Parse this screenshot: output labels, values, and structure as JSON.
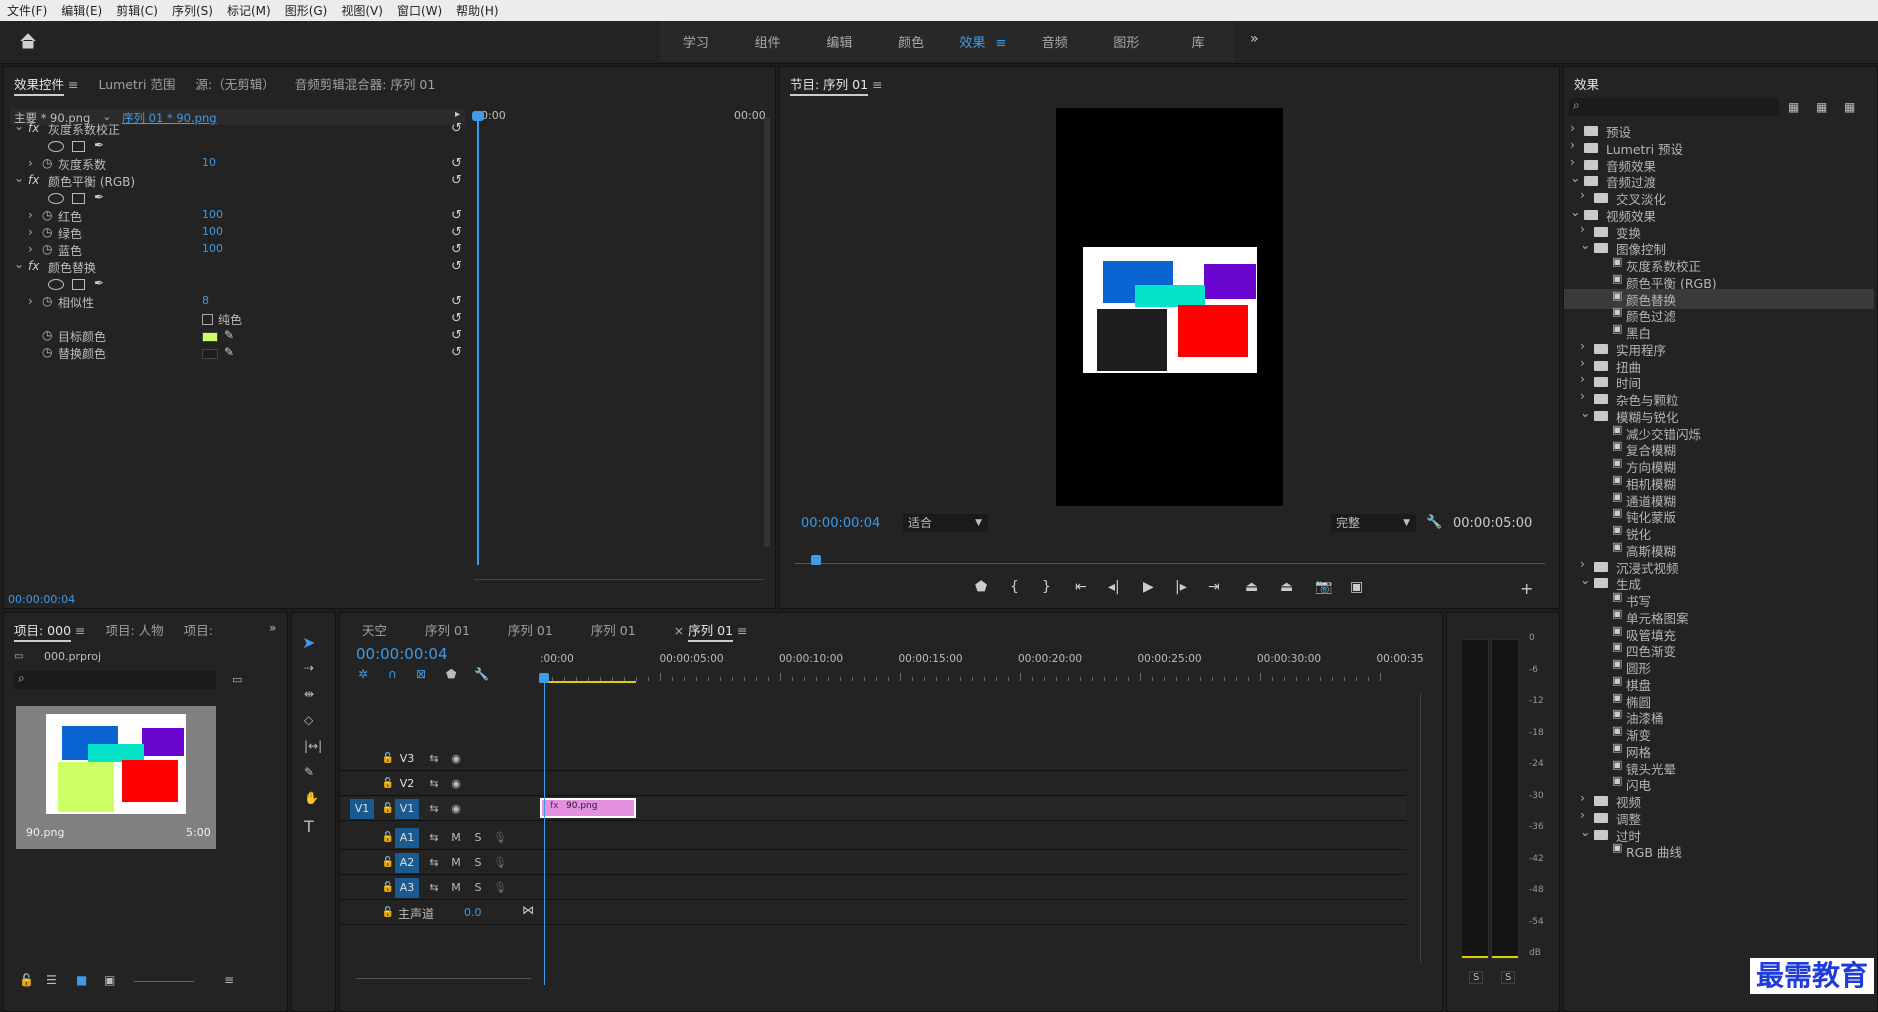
{
  "menu": [
    "文件(F)",
    "编辑(E)",
    "剪辑(C)",
    "序列(S)",
    "标记(M)",
    "图形(G)",
    "视图(V)",
    "窗口(W)",
    "帮助(H)"
  ],
  "workspaces": [
    "学习",
    "组件",
    "编辑",
    "颜色",
    "效果",
    "音频",
    "图形",
    "库"
  ],
  "effect_controls": {
    "tabs": [
      "效果控件",
      "Lumetri 范围",
      "源:（无剪辑）",
      "音频剪辑混合器: 序列 01"
    ],
    "master_clip": "主要 * 90.png",
    "sequence_clip": "序列 01 * 90.png",
    "time_start": "00:00",
    "time_end": "00:00",
    "current_time": "00:00:00:04",
    "effects": [
      {
        "name": "灰度系数校正",
        "params": [
          {
            "label": "灰度系数",
            "value": "10"
          }
        ]
      },
      {
        "name": "颜色平衡 (RGB)",
        "params": [
          {
            "label": "红色",
            "value": "100"
          },
          {
            "label": "绿色",
            "value": "100"
          },
          {
            "label": "蓝色",
            "value": "100"
          }
        ]
      },
      {
        "name": "颜色替换",
        "params": [
          {
            "label": "相似性",
            "value": "8"
          }
        ],
        "solid_label": "纯色",
        "target_label": "目标颜色",
        "replace_label": "替换颜色",
        "target_color": "#ccff66",
        "replace_color": "#1e1e1e"
      }
    ]
  },
  "program": {
    "title": "节目: 序列 01",
    "timecode": "00:00:00:04",
    "fit": "适合",
    "quality": "完整",
    "duration": "00:00:05:00"
  },
  "effects_panel": {
    "title": "效果",
    "items": [
      {
        "label": "预设",
        "indent": 0,
        "kind": "folder",
        "open": false
      },
      {
        "label": "Lumetri 预设",
        "indent": 0,
        "kind": "folder",
        "open": false
      },
      {
        "label": "音频效果",
        "indent": 0,
        "kind": "folder",
        "open": false
      },
      {
        "label": "音频过渡",
        "indent": 0,
        "kind": "folder",
        "open": true
      },
      {
        "label": "交叉淡化",
        "indent": 1,
        "kind": "folder",
        "open": false
      },
      {
        "label": "视频效果",
        "indent": 0,
        "kind": "folder",
        "open": true
      },
      {
        "label": "变换",
        "indent": 1,
        "kind": "folder",
        "open": false
      },
      {
        "label": "图像控制",
        "indent": 1,
        "kind": "folder",
        "open": true
      },
      {
        "label": "灰度系数校正",
        "indent": 2,
        "kind": "fx"
      },
      {
        "label": "颜色平衡 (RGB)",
        "indent": 2,
        "kind": "fx"
      },
      {
        "label": "颜色替换",
        "indent": 2,
        "kind": "fx",
        "selected": true
      },
      {
        "label": "颜色过滤",
        "indent": 2,
        "kind": "fx"
      },
      {
        "label": "黑白",
        "indent": 2,
        "kind": "fx"
      },
      {
        "label": "实用程序",
        "indent": 1,
        "kind": "folder",
        "open": false
      },
      {
        "label": "扭曲",
        "indent": 1,
        "kind": "folder",
        "open": false
      },
      {
        "label": "时间",
        "indent": 1,
        "kind": "folder",
        "open": false
      },
      {
        "label": "杂色与颗粒",
        "indent": 1,
        "kind": "folder",
        "open": false
      },
      {
        "label": "模糊与锐化",
        "indent": 1,
        "kind": "folder",
        "open": true
      },
      {
        "label": "减少交错闪烁",
        "indent": 2,
        "kind": "fx"
      },
      {
        "label": "复合模糊",
        "indent": 2,
        "kind": "fx"
      },
      {
        "label": "方向模糊",
        "indent": 2,
        "kind": "fx"
      },
      {
        "label": "相机模糊",
        "indent": 2,
        "kind": "fx"
      },
      {
        "label": "通道模糊",
        "indent": 2,
        "kind": "fx"
      },
      {
        "label": "钝化蒙版",
        "indent": 2,
        "kind": "fx"
      },
      {
        "label": "锐化",
        "indent": 2,
        "kind": "fx"
      },
      {
        "label": "高斯模糊",
        "indent": 2,
        "kind": "fx"
      },
      {
        "label": "沉浸式视频",
        "indent": 1,
        "kind": "folder",
        "open": false
      },
      {
        "label": "生成",
        "indent": 1,
        "kind": "folder",
        "open": true
      },
      {
        "label": "书写",
        "indent": 2,
        "kind": "fx"
      },
      {
        "label": "单元格图案",
        "indent": 2,
        "kind": "fx"
      },
      {
        "label": "吸管填充",
        "indent": 2,
        "kind": "fx"
      },
      {
        "label": "四色渐变",
        "indent": 2,
        "kind": "fx"
      },
      {
        "label": "圆形",
        "indent": 2,
        "kind": "fx"
      },
      {
        "label": "棋盘",
        "indent": 2,
        "kind": "fx"
      },
      {
        "label": "椭圆",
        "indent": 2,
        "kind": "fx"
      },
      {
        "label": "油漆桶",
        "indent": 2,
        "kind": "fx"
      },
      {
        "label": "渐变",
        "indent": 2,
        "kind": "fx"
      },
      {
        "label": "网格",
        "indent": 2,
        "kind": "fx"
      },
      {
        "label": "镜头光晕",
        "indent": 2,
        "kind": "fx"
      },
      {
        "label": "闪电",
        "indent": 2,
        "kind": "fx"
      },
      {
        "label": "视频",
        "indent": 1,
        "kind": "folder",
        "open": false
      },
      {
        "label": "调整",
        "indent": 1,
        "kind": "folder",
        "open": false
      },
      {
        "label": "过时",
        "indent": 1,
        "kind": "folder",
        "open": true
      },
      {
        "label": "RGB 曲线",
        "indent": 2,
        "kind": "fx"
      }
    ]
  },
  "project": {
    "tabs": [
      "项目: 000",
      "项目: 人物",
      "项目:"
    ],
    "file": "000.prproj",
    "clip_name": "90.png",
    "clip_duration": "5:00"
  },
  "timeline": {
    "tabs": [
      "天空",
      "序列 01",
      "序列 01",
      "序列 01",
      "序列 01"
    ],
    "timecode": "00:00:00:04",
    "ruler": [
      ":00:00",
      "00:00:05:00",
      "00:00:10:00",
      "00:00:15:00",
      "00:00:20:00",
      "00:00:25:00",
      "00:00:30:00",
      "00:00:35"
    ],
    "video_tracks": [
      "V3",
      "V2",
      "V1"
    ],
    "audio_tracks": [
      "A1",
      "A2",
      "A3"
    ],
    "source_patch": "V1",
    "master_label": "主声道",
    "master_value": "0.0",
    "clip_label": "90.png",
    "track_buttons": {
      "mute": "M",
      "solo": "S"
    }
  },
  "meter": {
    "scale": [
      "0",
      "-6",
      "-12",
      "-18",
      "-24",
      "-30",
      "-36",
      "-42",
      "-48",
      "-54",
      "dB"
    ],
    "solo": [
      "S",
      "S"
    ]
  },
  "watermark": "最需教育"
}
